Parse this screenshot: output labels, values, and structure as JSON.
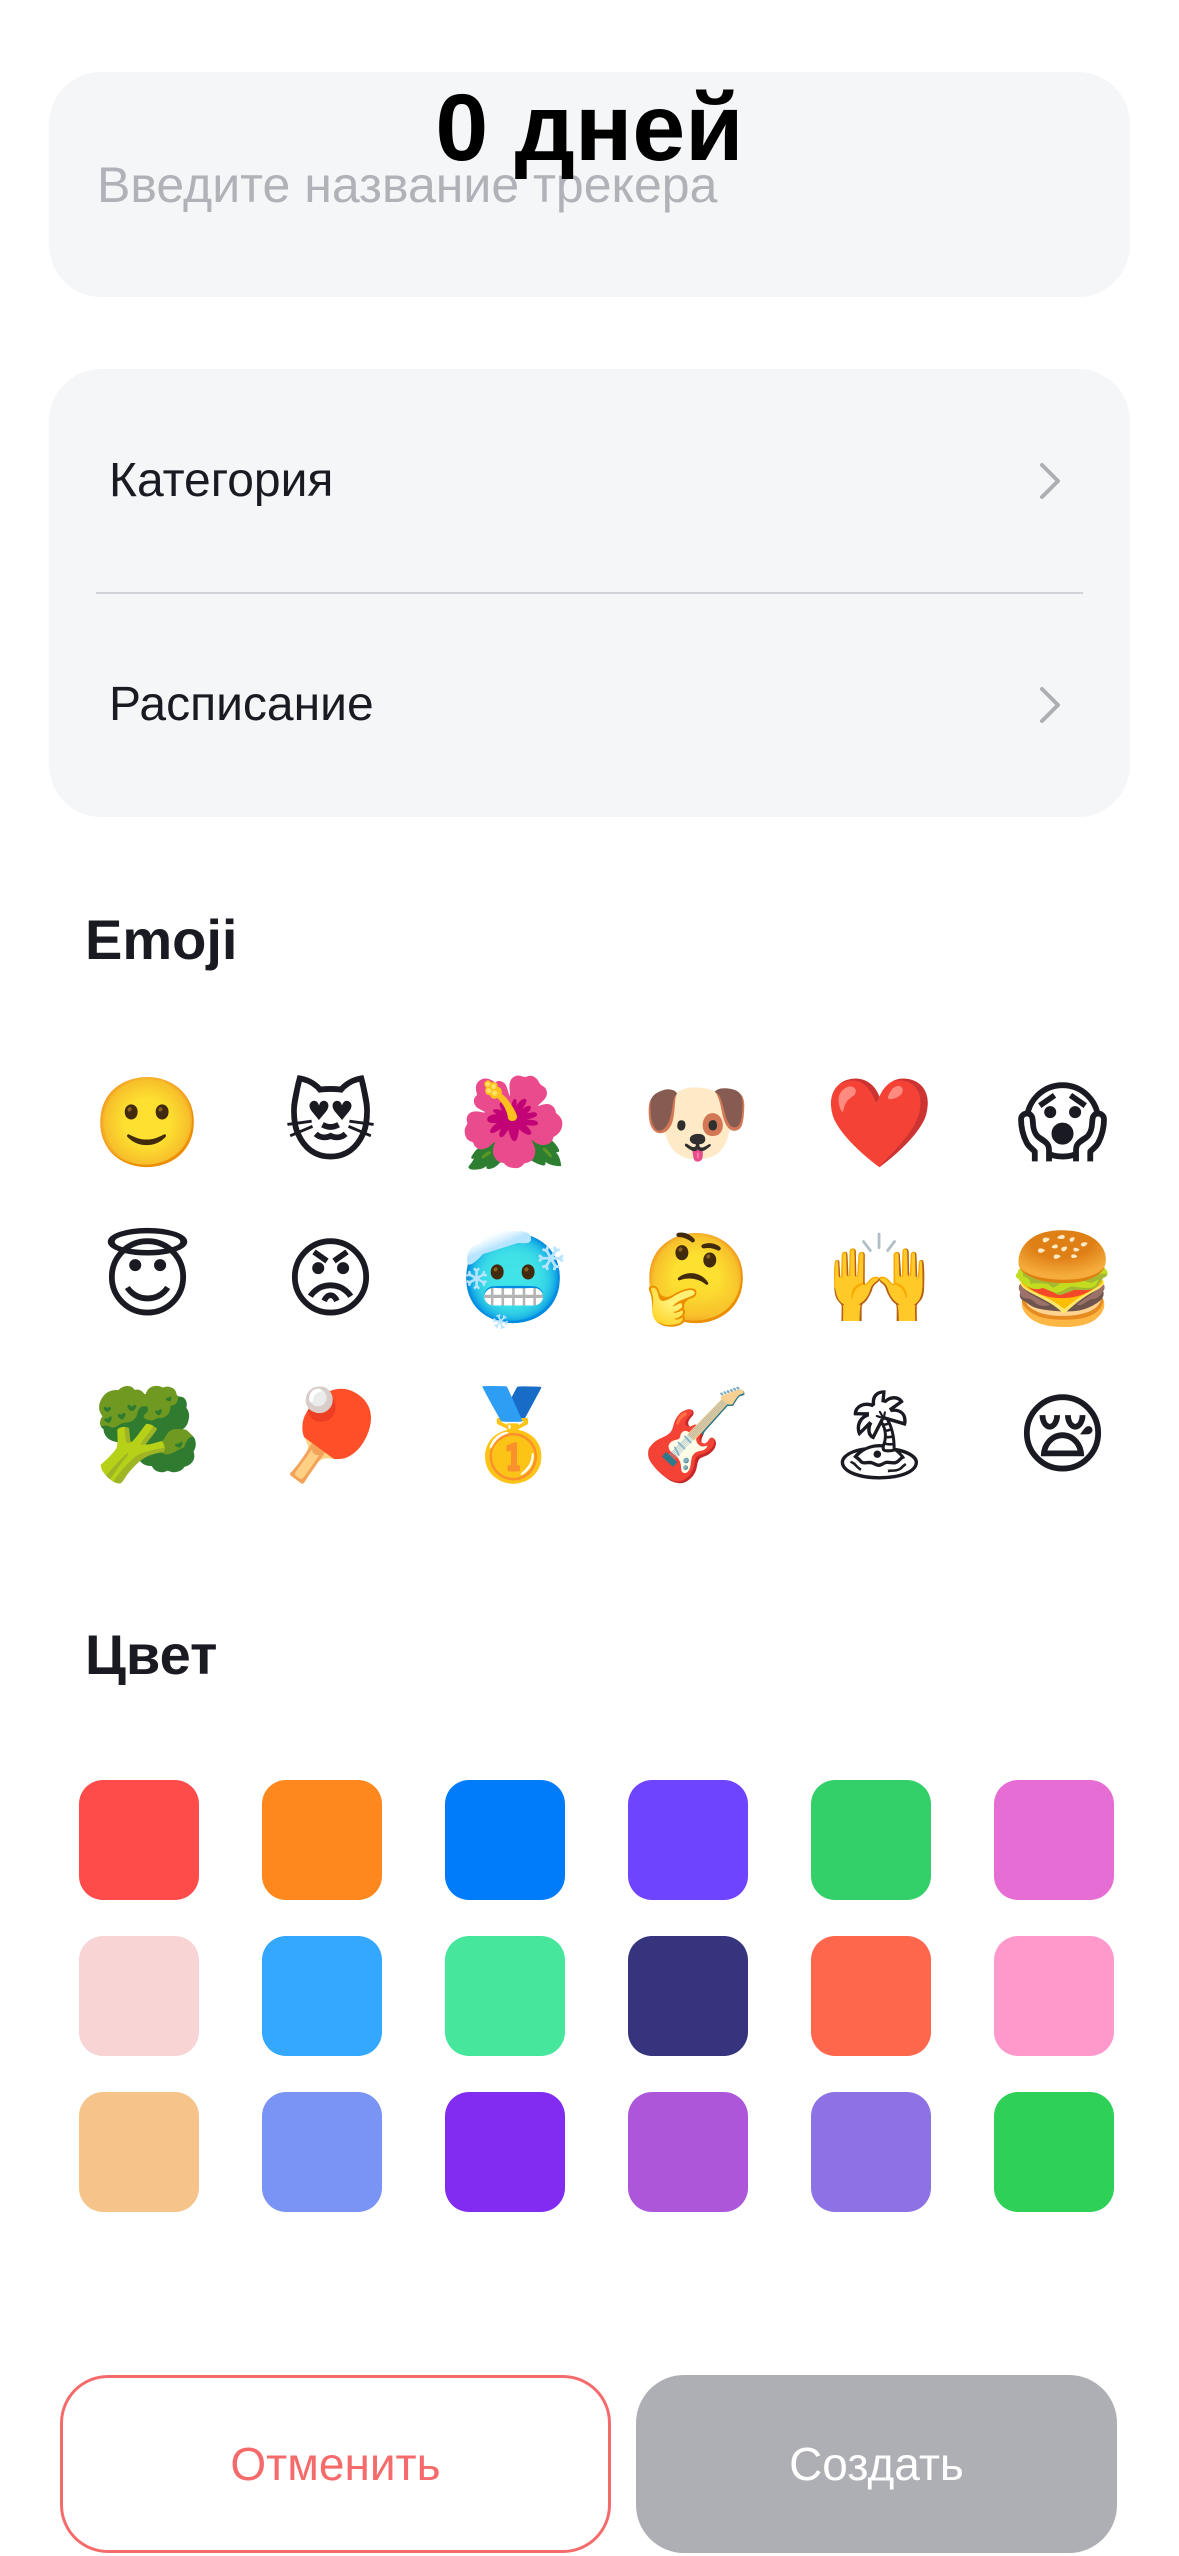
{
  "header": {
    "days_counter": "0 дней"
  },
  "name_field": {
    "placeholder": "Введите название трекера",
    "value": ""
  },
  "settings": {
    "rows": [
      {
        "label": "Категория",
        "icon": "chevron-right-icon"
      },
      {
        "label": "Расписание",
        "icon": "chevron-right-icon"
      }
    ]
  },
  "emoji_section": {
    "title": "Emoji",
    "items": [
      {
        "glyph": "🙂",
        "name": "slightly-smiling-face"
      },
      {
        "glyph": "😻",
        "name": "smiling-cat-heart-eyes"
      },
      {
        "glyph": "🌺",
        "name": "hibiscus"
      },
      {
        "glyph": "🐶",
        "name": "dog-face"
      },
      {
        "glyph": "❤️",
        "name": "red-heart"
      },
      {
        "glyph": "😱",
        "name": "face-screaming-in-fear"
      },
      {
        "glyph": "😇",
        "name": "smiling-face-with-halo"
      },
      {
        "glyph": "😡",
        "name": "enraged-face"
      },
      {
        "glyph": "🥶",
        "name": "cold-face"
      },
      {
        "glyph": "🤔",
        "name": "thinking-face"
      },
      {
        "glyph": "🙌",
        "name": "raising-hands"
      },
      {
        "glyph": "🍔",
        "name": "hamburger"
      },
      {
        "glyph": "🥦",
        "name": "broccoli"
      },
      {
        "glyph": "🏓",
        "name": "ping-pong"
      },
      {
        "glyph": "🥇",
        "name": "first-place-medal"
      },
      {
        "glyph": "🎸",
        "name": "guitar"
      },
      {
        "glyph": "🏝",
        "name": "desert-island"
      },
      {
        "glyph": "😪",
        "name": "sleepy-face"
      }
    ]
  },
  "color_section": {
    "title": "Цвет",
    "colors": [
      "#FD4C49",
      "#FF881E",
      "#007BFA",
      "#6E44FE",
      "#33CF69",
      "#E66DD4",
      "#F9D4D4",
      "#34A7FE",
      "#46E69D",
      "#35347C",
      "#FF674D",
      "#FF99CC",
      "#F6C48B",
      "#7994F5",
      "#832CF1",
      "#AD56DA",
      "#8D72E6",
      "#2FD058"
    ]
  },
  "actions": {
    "cancel_label": "Отменить",
    "create_label": "Создать"
  },
  "theme": {
    "card_background": "#F5F6F8",
    "cancel_color": "#F56B6C",
    "disabled_color": "#AEAFB4"
  }
}
